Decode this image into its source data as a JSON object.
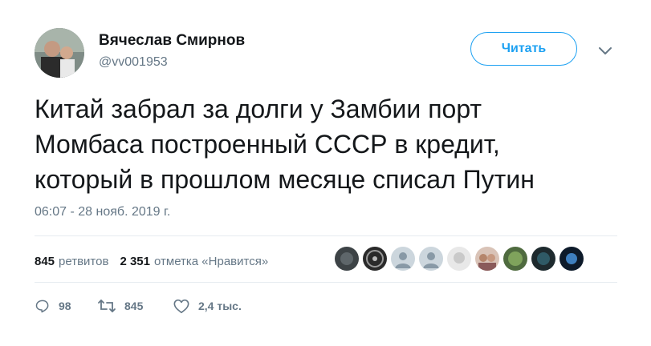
{
  "author": {
    "name": "Вячеслав Смирнов",
    "handle": "@vv001953"
  },
  "follow_label": "Читать",
  "tweet": {
    "text": "Китай забрал за долги у Замбии порт\nМомбаса построенный СССР в кредит,\nкоторый в прошлом месяце списал Путин",
    "timestamp": "06:07 - 28 нояб. 2019 г."
  },
  "stats": {
    "retweets_count": "845",
    "retweets_label": "ретвитов",
    "likes_count": "2 351",
    "likes_label": "отметка «Нравится»"
  },
  "likers": [
    {
      "icon": "liker-avatar-dark"
    },
    {
      "icon": "liker-avatar-dial"
    },
    {
      "icon": "default-avatar-icon"
    },
    {
      "icon": "default-avatar-icon"
    },
    {
      "icon": "liker-avatar-light"
    },
    {
      "icon": "liker-avatar-group"
    },
    {
      "icon": "liker-avatar-green"
    },
    {
      "icon": "liker-avatar-teal"
    },
    {
      "icon": "liker-avatar-blue"
    }
  ],
  "actions": {
    "replies": "98",
    "retweets": "845",
    "likes": "2,4 тыс."
  },
  "colors": {
    "accent": "#1da1f2",
    "muted": "#657786",
    "text": "#14171a"
  }
}
